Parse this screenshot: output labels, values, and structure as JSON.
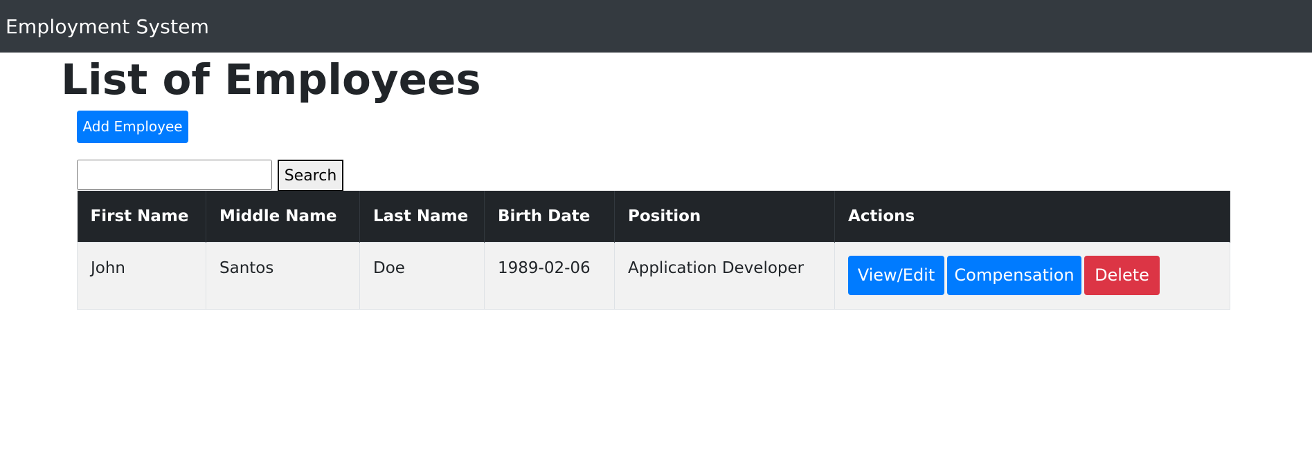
{
  "navbar": {
    "brand": "Employment System"
  },
  "page": {
    "title": "List of Employees"
  },
  "toolbar": {
    "add_label": "Add Employee"
  },
  "search": {
    "value": "",
    "placeholder": "",
    "button_label": "Search"
  },
  "table": {
    "headers": [
      "First Name",
      "Middle Name",
      "Last Name",
      "Birth Date",
      "Position",
      "Actions"
    ],
    "rows": [
      {
        "first_name": "John",
        "middle_name": "Santos",
        "last_name": "Doe",
        "birth_date": "1989-02-06",
        "position": "Application Developer",
        "actions": {
          "view_edit": "View/Edit",
          "compensation": "Compensation",
          "delete": "Delete"
        }
      }
    ]
  },
  "colors": {
    "navbar": "#343a40",
    "primary": "#007bff",
    "danger": "#dc3545",
    "table_header": "#212529",
    "row_background": "#f2f2f2"
  }
}
